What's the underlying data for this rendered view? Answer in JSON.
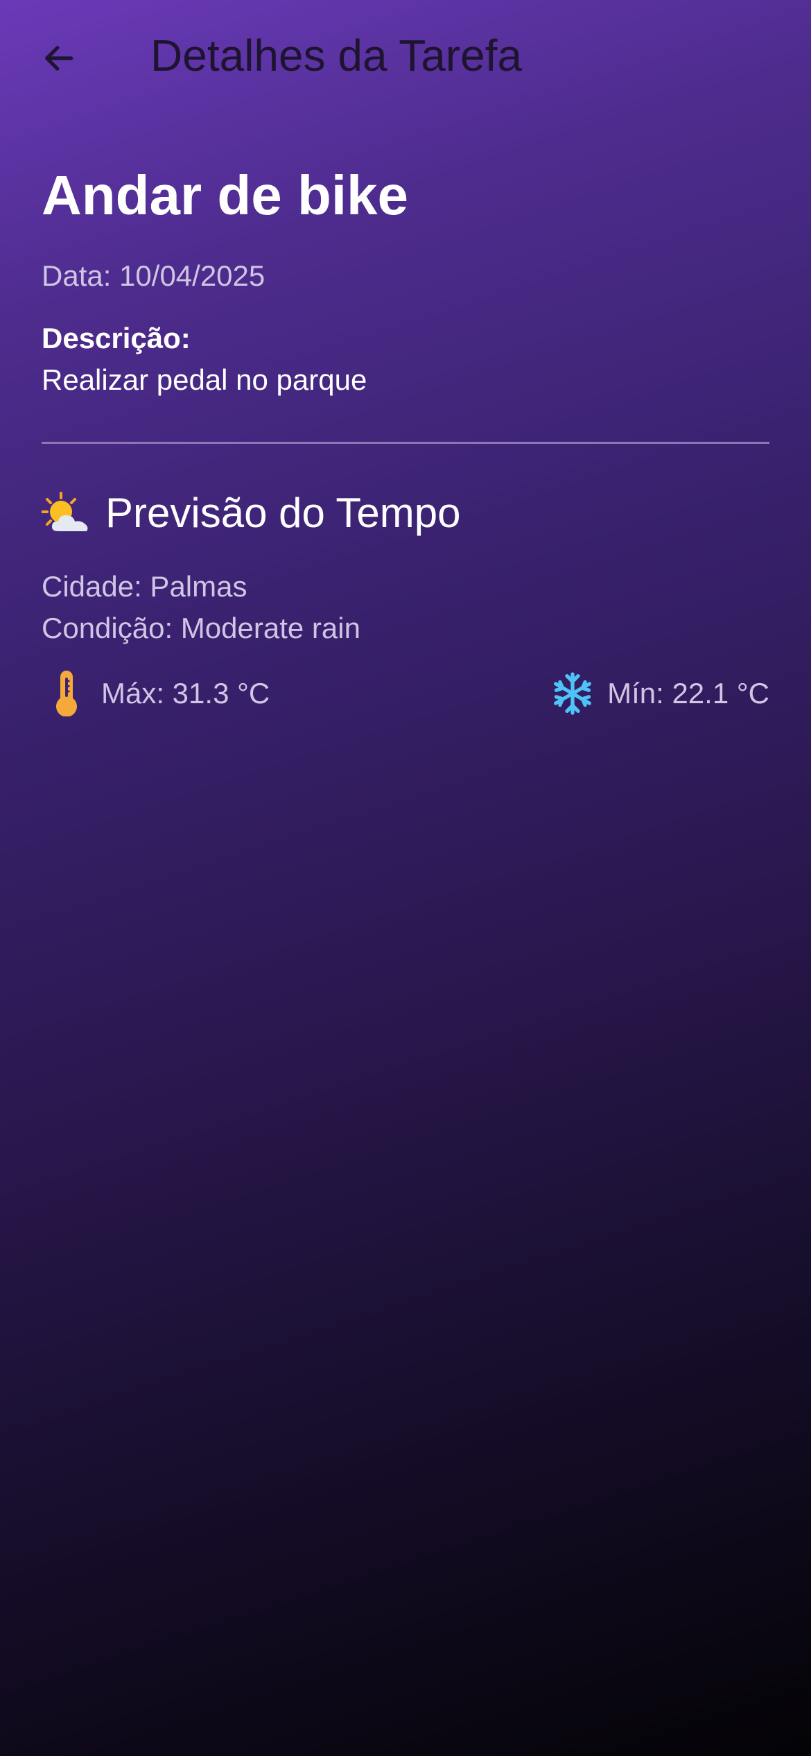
{
  "app_bar": {
    "title": "Detalhes da Tarefa",
    "back_icon": "arrow-back-icon"
  },
  "task": {
    "title": "Andar de bike",
    "date": "Data: 10/04/2025",
    "description_label": "Descrição:",
    "description": "Realizar pedal no parque"
  },
  "weather": {
    "icon": "sun-behind-cloud-icon",
    "title": "Previsão do Tempo",
    "city": "Cidade: Palmas",
    "condition": "Condição: Moderate rain",
    "max": "Máx: 31.3 °C",
    "max_icon": "thermometer-icon",
    "min": "Mín: 22.1 °C",
    "min_icon": "snowflake-icon"
  },
  "colors": {
    "gradient_top": "#6a3ab8",
    "gradient_bottom": "#040306",
    "secondary_text": "#cfc5e4",
    "thermometer": "#f6a93b",
    "snowflake": "#4fc3f7"
  }
}
